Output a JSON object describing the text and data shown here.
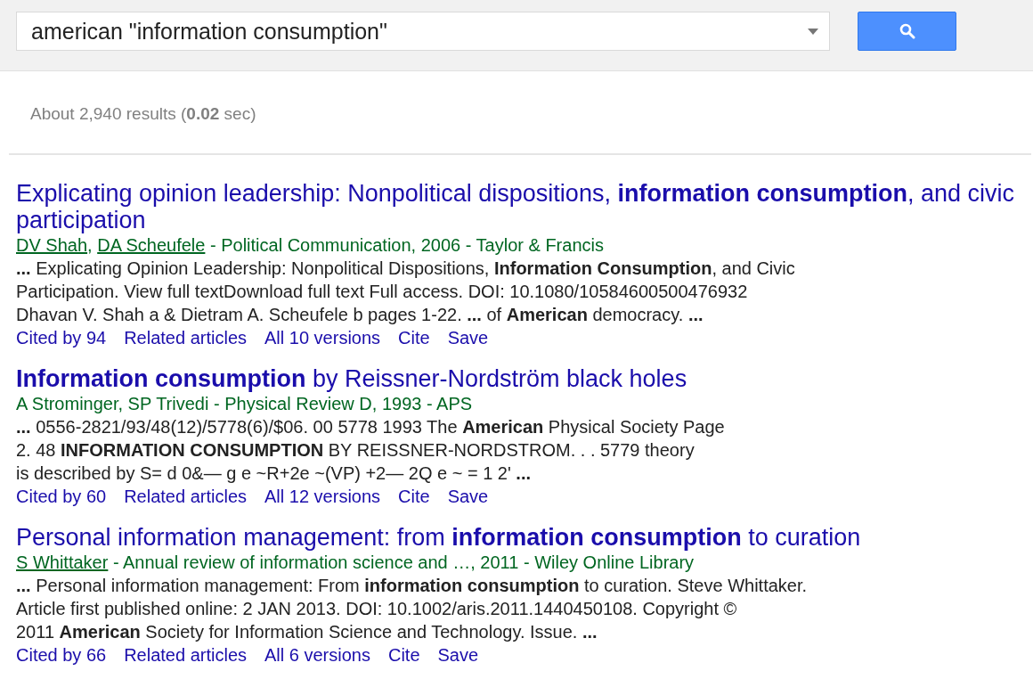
{
  "search": {
    "value": "american \"information consumption\""
  },
  "result_stats": "About 2,940 results (**0.02** sec)",
  "results": [
    {
      "title": "Explicating opinion leadership: Nonpolitical dispositions, **information consumption**, and civic participation",
      "meta": [
        {
          "text": "DV Shah",
          "linked": true
        },
        {
          "text": ", ",
          "linked": false
        },
        {
          "text": "DA Scheufele",
          "linked": true
        },
        {
          "text": " - Political Communication, 2006 - Taylor & Francis",
          "linked": false
        }
      ],
      "snippet": [
        "**...** Explicating Opinion Leadership: Nonpolitical Dispositions, **Information Consumption**, and Civic",
        "Participation. View full textDownload full text Full access. DOI: 10.1080/10584600500476932",
        "Dhavan V. Shah a & Dietram A. Scheufele b pages 1-22. **...** of **American** democracy. **...**"
      ],
      "links": [
        "Cited by 94",
        "Related articles",
        "All 10 versions",
        "Cite",
        "Save"
      ]
    },
    {
      "title": "**Information consumption** by Reissner-Nordström black holes",
      "meta": [
        {
          "text": "A Strominger, SP Trivedi - Physical Review D, 1993 - APS",
          "linked": false
        }
      ],
      "snippet": [
        "**...** 0556-2821/93/48(12)/5778(6)/$06. 00 5778 1993 The **American** Physical Society Page",
        "2. 48 **INFORMATION CONSUMPTION** BY REISSNER-NORDSTROM. . . 5779 theory",
        "is described by S= d 0&— g e ~R+2e ~(VP) +2— 2Q e ~ = 1 2' **...**"
      ],
      "links": [
        "Cited by 60",
        "Related articles",
        "All 12 versions",
        "Cite",
        "Save"
      ]
    },
    {
      "title": "Personal information management: from **information consumption** to curation",
      "meta": [
        {
          "text": "S Whittaker",
          "linked": true
        },
        {
          "text": " - Annual review of information science and …, 2011 - Wiley Online Library",
          "linked": false
        }
      ],
      "snippet": [
        "**...** Personal information management: From **information consumption** to curation. Steve Whittaker.",
        "Article first published online: 2 JAN 2013. DOI: 10.1002/aris.2011.1440450108. Copyright ©",
        "2011 **American** Society for Information Science and Technology. Issue. **...**"
      ],
      "links": [
        "Cited by 66",
        "Related articles",
        "All 6 versions",
        "Cite",
        "Save"
      ]
    }
  ]
}
